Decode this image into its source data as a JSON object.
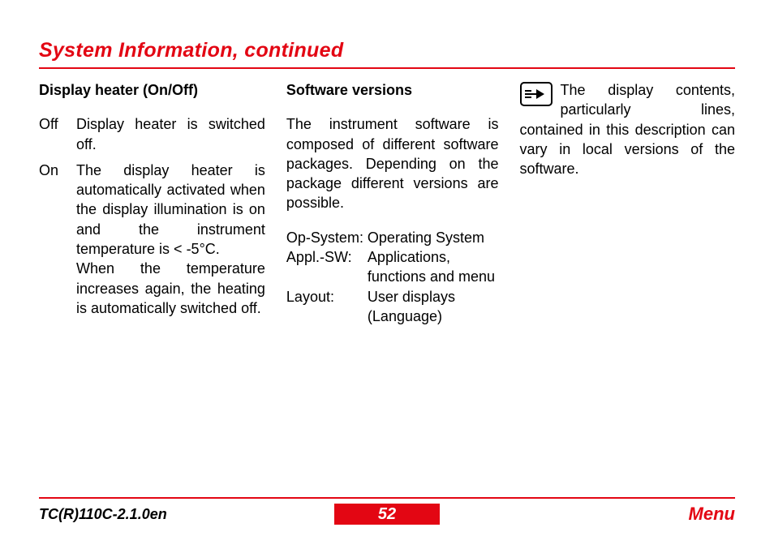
{
  "title": "System Information, continued",
  "col1": {
    "heading": "Display heater (On/Off)",
    "off_label": "Off",
    "off_text": "Display heater is switched off.",
    "on_label": "On",
    "on_text": "The display heater is automatically activated when the display illumination is on and the instrument temperature is < -5°C.\nWhen the temperature increases again, the heating is automatically switched off."
  },
  "col2": {
    "heading": "Software versions",
    "intro": "The instrument software is composed of different software packages. Depending on the package different versions are possible.",
    "rows": [
      {
        "label": "Op-System:",
        "text": "Operating System"
      },
      {
        "label": "Appl.-SW:",
        "text": "Applications, functions and menu"
      },
      {
        "label": "Layout:",
        "text": "User displays (Language)"
      }
    ]
  },
  "col3": {
    "note": "The display contents, particularly lines, contained in this description can vary in local versions of the software."
  },
  "footer": {
    "left": "TC(R)110C-2.1.0en",
    "page": "52",
    "right": "Menu"
  }
}
